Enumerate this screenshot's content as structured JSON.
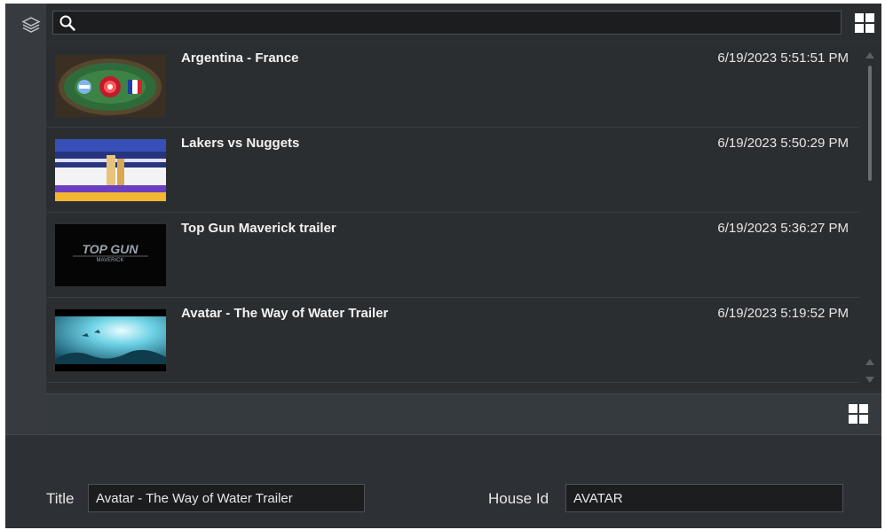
{
  "search": {
    "value": "",
    "placeholder": ""
  },
  "icons": {
    "layers": "layers-icon",
    "search": "search-icon",
    "grid": "grid-view-icon"
  },
  "items": [
    {
      "title": "Argentina - France",
      "date": "6/19/2023 5:51:51 PM",
      "thumbnail": "soccer-stadium-thumbnail"
    },
    {
      "title": "Lakers vs Nuggets",
      "date": "6/19/2023 5:50:29 PM",
      "thumbnail": "basketball-court-thumbnail"
    },
    {
      "title": "Top Gun Maverick trailer",
      "date": "6/19/2023 5:36:27 PM",
      "thumbnail": "top-gun-logo-thumbnail",
      "thumb_text": [
        "TOP GUN",
        "MAVERICK"
      ]
    },
    {
      "title": "Avatar - The Way of Water Trailer",
      "date": "6/19/2023 5:19:52 PM",
      "thumbnail": "underwater-thumbnail"
    }
  ],
  "form": {
    "title_label": "Title",
    "title_value": "Avatar - The Way of Water Trailer",
    "house_id_label": "House Id",
    "house_id_value": "AVATAR"
  },
  "colors": {
    "background": "#2d3135",
    "panel": "#2b2e31",
    "field": "#1b1d1f",
    "text": "#e8e8e8"
  }
}
